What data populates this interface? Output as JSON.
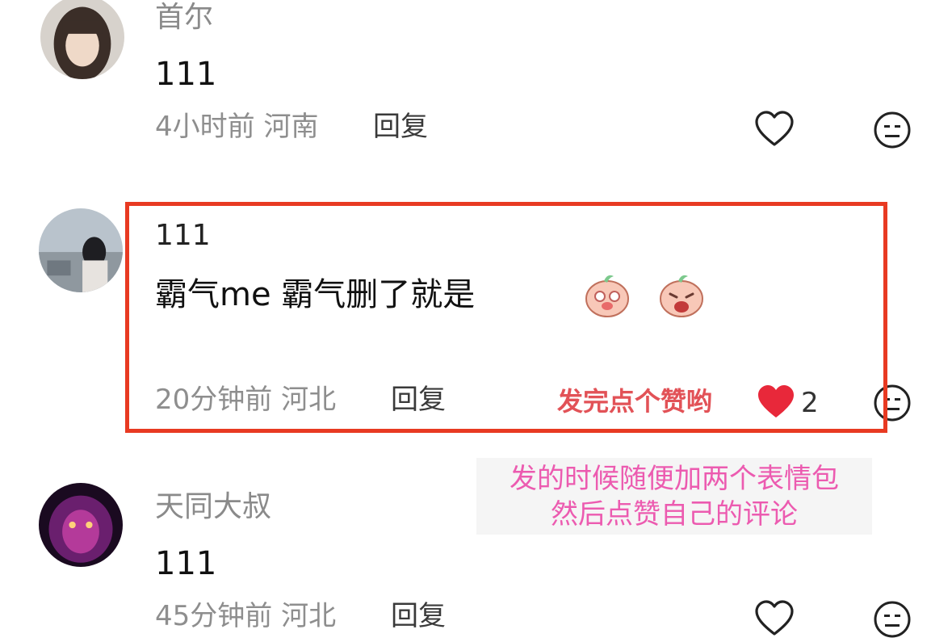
{
  "comments": [
    {
      "name": "首尔",
      "text": "111",
      "time": "4小时前",
      "location": "河南",
      "reply": "回复"
    },
    {
      "name": "111",
      "text": "霸气me  霸气删了就是",
      "time": "20分钟前",
      "location": "河北",
      "reply": "回复",
      "likes": "2",
      "liked": true,
      "stickers": [
        "crying-peach-sticker",
        "shouting-peach-sticker"
      ]
    },
    {
      "name": "天同大叔",
      "text": "111",
      "time": "45分钟前",
      "location": "河北",
      "reply": "回复"
    }
  ],
  "annotations": {
    "like_hint": "发完点个赞哟",
    "note_line1": "发的时候随便加两个表情包",
    "note_line2": "然后点赞自己的评论"
  },
  "colors": {
    "highlight_border": "#e83a22",
    "liked_heart": "#e8283a",
    "hint_text": "#e25257",
    "note_text": "#ec5bb0"
  },
  "icons": [
    "heart-icon",
    "neutral-face-icon"
  ]
}
